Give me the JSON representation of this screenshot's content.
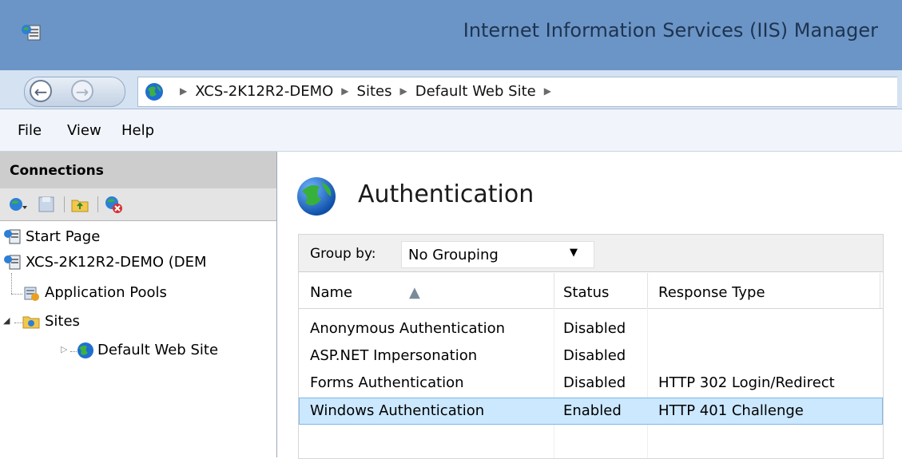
{
  "window": {
    "title": "Internet Information Services (IIS) Manager",
    "icons": {
      "app": "iis-manager-icon"
    }
  },
  "address_bar": {
    "back_icon": "back-arrow-icon",
    "forward_icon": "forward-arrow-icon",
    "breadcrumbs": [
      "XCS-2K12R2-DEMO",
      "Sites",
      "Default Web Site"
    ]
  },
  "menu": {
    "items": [
      "File",
      "View",
      "Help"
    ]
  },
  "connections": {
    "title": "Connections",
    "toolbar_icons": [
      "connect-icon",
      "save-icon",
      "up-folder-icon",
      "delete-connection-icon"
    ],
    "tree": [
      {
        "label": "Start Page",
        "icon": "start-page-icon"
      },
      {
        "label": "XCS-2K12R2-DEMO (DEM",
        "icon": "server-icon"
      },
      {
        "label": "Application Pools",
        "icon": "app-pools-icon"
      },
      {
        "label": "Sites",
        "icon": "sites-folder-icon"
      },
      {
        "label": "Default Web Site",
        "icon": "globe-icon"
      }
    ]
  },
  "feature": {
    "title": "Authentication",
    "icon": "globe-icon",
    "group_by_label": "Group by:",
    "group_by_value": "No Grouping",
    "columns": [
      "Name",
      "Status",
      "Response Type"
    ],
    "rows": [
      {
        "name": "Anonymous Authentication",
        "status": "Disabled",
        "response": ""
      },
      {
        "name": "ASP.NET Impersonation",
        "status": "Disabled",
        "response": ""
      },
      {
        "name": "Forms Authentication",
        "status": "Disabled",
        "response": "HTTP 302 Login/Redirect"
      },
      {
        "name": "Windows Authentication",
        "status": "Enabled",
        "response": "HTTP 401 Challenge"
      }
    ],
    "selected_row": 3
  },
  "colors": {
    "titlebar": "#6b95c6",
    "address_bar": "#d4e2f2",
    "selection": "#cce8ff"
  }
}
